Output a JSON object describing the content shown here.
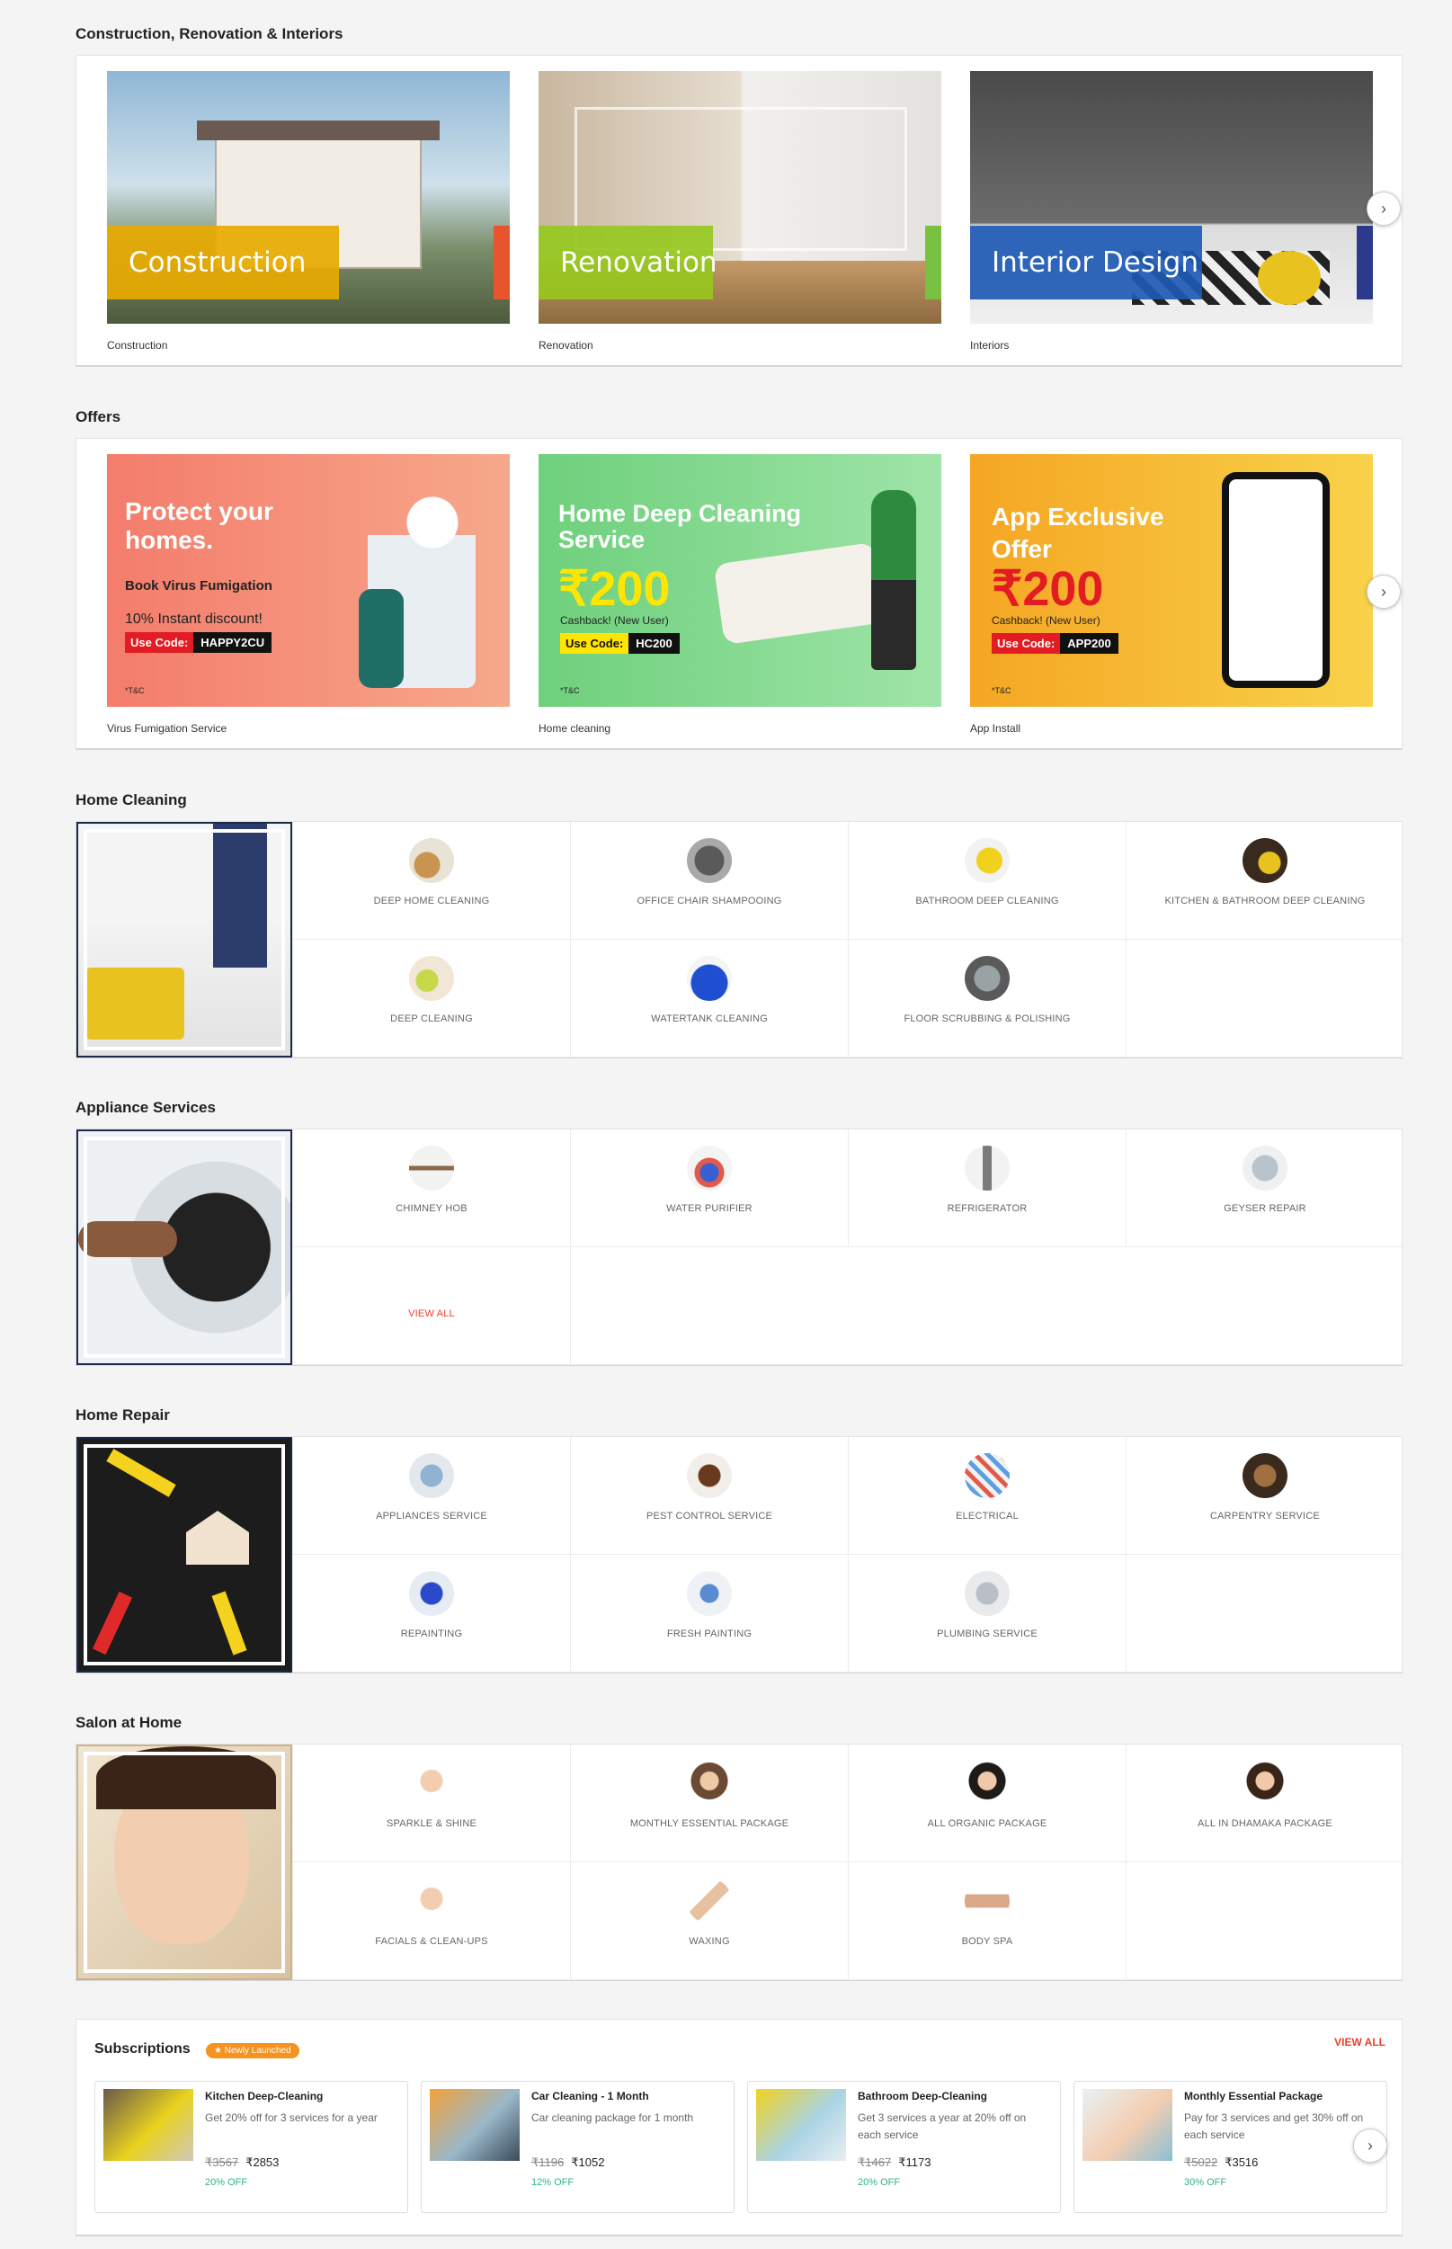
{
  "construction": {
    "title": "Construction, Renovation & Interiors",
    "cards": [
      {
        "label": "Construction",
        "caption": "Construction"
      },
      {
        "label": "Renovation",
        "caption": "Renovation"
      },
      {
        "label": "Interior Design",
        "caption": "Interiors"
      }
    ]
  },
  "offers": {
    "title": "Offers",
    "cards": [
      {
        "headline": "Protect your homes.",
        "sub": "Book Virus Fumigation",
        "discount": "10% Instant discount!",
        "code_label": "Use Code:",
        "code": "HAPPY2CU",
        "tc": "*T&C",
        "caption": "Virus Fumigation Service"
      },
      {
        "headline": "Home Deep Cleaning Service",
        "amount": "₹200",
        "cashback": "Cashback! (New User)",
        "code_label": "Use Code:",
        "code": "HC200",
        "tc": "*T&C",
        "caption": "Home cleaning"
      },
      {
        "headline": "App Exclusive Offer",
        "amount": "₹200",
        "cashback": "Cashback! (New User)",
        "code_label": "Use Code:",
        "code": "APP200",
        "tc": "*T&C",
        "caption": "App Install"
      }
    ]
  },
  "home_cleaning": {
    "title": "Home Cleaning",
    "items": [
      "DEEP HOME CLEANING",
      "OFFICE CHAIR SHAMPOOING",
      "BATHROOM DEEP CLEANING",
      "KITCHEN & BATHROOM DEEP CLEANING",
      "DEEP CLEANING",
      "WATERTANK CLEANING",
      "FLOOR SCRUBBING & POLISHING"
    ]
  },
  "appliance": {
    "title": "Appliance Services",
    "items": [
      "CHIMNEY HOB",
      "WATER PURIFIER",
      "REFRIGERATOR",
      "GEYSER REPAIR"
    ],
    "view_all": "VIEW ALL"
  },
  "home_repair": {
    "title": "Home Repair",
    "items": [
      "APPLIANCES SERVICE",
      "PEST CONTROL SERVICE",
      "ELECTRICAL",
      "CARPENTRY SERVICE",
      "REPAINTING",
      "FRESH PAINTING",
      "PLUMBING SERVICE"
    ]
  },
  "salon": {
    "title": "Salon at Home",
    "items": [
      "SPARKLE & SHINE",
      "MONTHLY ESSENTIAL PACKAGE",
      "ALL ORGANIC PACKAGE",
      "ALL IN DHAMAKA PACKAGE",
      "FACIALS & CLEAN-UPS",
      "WAXING",
      "BODY SPA"
    ]
  },
  "subscriptions": {
    "title": "Subscriptions",
    "badge": "★ Newly Launched",
    "view_all": "VIEW ALL",
    "cards": [
      {
        "title": "Kitchen Deep-Cleaning",
        "desc": "Get 20% off for 3 services for a year",
        "old": "₹3567",
        "new": "₹2853",
        "off": "20% OFF"
      },
      {
        "title": "Car Cleaning - 1 Month",
        "desc": "Car cleaning package for 1 month",
        "old": "₹1196",
        "new": "₹1052",
        "off": "12% OFF"
      },
      {
        "title": "Bathroom Deep-Cleaning",
        "desc": "Get 3 services a year at 20% off on each service",
        "old": "₹1467",
        "new": "₹1173",
        "off": "20% OFF"
      },
      {
        "title": "Monthly Essential Package",
        "desc": "Pay for 3 services and get 30% off on each service",
        "old": "₹5022",
        "new": "₹3516",
        "off": "30% OFF"
      }
    ]
  },
  "colors": {
    "accent": "#e8412c",
    "badge": "#f6921e",
    "discount_green": "#2bb38f"
  }
}
